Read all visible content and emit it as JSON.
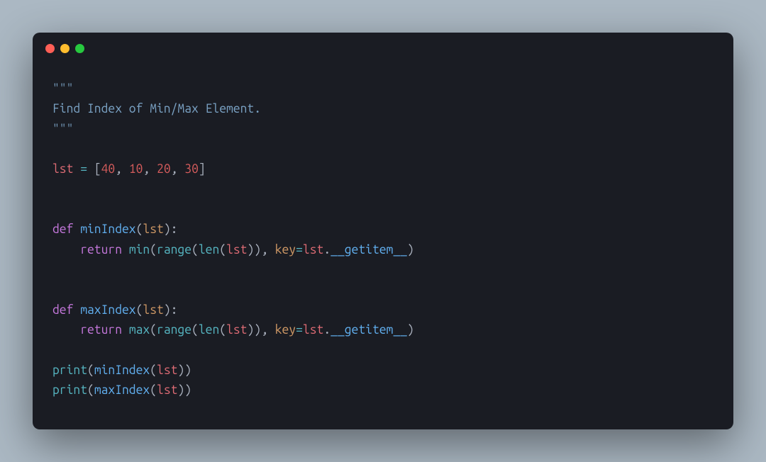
{
  "window": {
    "traffic_lights": [
      "red",
      "yellow",
      "green"
    ]
  },
  "code": {
    "docstring_open": "\"\"\"",
    "docstring_text": "Find Index of Min/Max Element.",
    "docstring_close": "\"\"\"",
    "assign_line": {
      "var": "lst",
      "eq": " = ",
      "lbrack": "[",
      "n1": "40",
      "c1": ", ",
      "n2": "10",
      "c2": ", ",
      "n3": "20",
      "c3": ", ",
      "n4": "30",
      "rbrack": "]"
    },
    "def1": {
      "kw": "def ",
      "name": "minIndex",
      "lp": "(",
      "param": "lst",
      "rp": "):",
      "indent": "    ",
      "ret": "return ",
      "builtin": "min",
      "args_open": "(",
      "range": "range",
      "rl": "(",
      "len": "len",
      "ll": "(",
      "lvar": "lst",
      "lr": ")",
      "rr": ")",
      "comma": ", ",
      "key": "key",
      "eq": "=",
      "obj": "lst",
      "dot": ".",
      "dunder": "__getitem__",
      "args_close": ")"
    },
    "def2": {
      "kw": "def ",
      "name": "maxIndex",
      "lp": "(",
      "param": "lst",
      "rp": "):",
      "indent": "    ",
      "ret": "return ",
      "builtin": "max",
      "args_open": "(",
      "range": "range",
      "rl": "(",
      "len": "len",
      "ll": "(",
      "lvar": "lst",
      "lr": ")",
      "rr": ")",
      "comma": ", ",
      "key": "key",
      "eq": "=",
      "obj": "lst",
      "dot": ".",
      "dunder": "__getitem__",
      "args_close": ")"
    },
    "call1": {
      "print": "print",
      "lp": "(",
      "fn": "minIndex",
      "il": "(",
      "arg": "lst",
      "ir": ")",
      "rp": ")"
    },
    "call2": {
      "print": "print",
      "lp": "(",
      "fn": "maxIndex",
      "il": "(",
      "arg": "lst",
      "ir": ")",
      "rp": ")"
    }
  }
}
